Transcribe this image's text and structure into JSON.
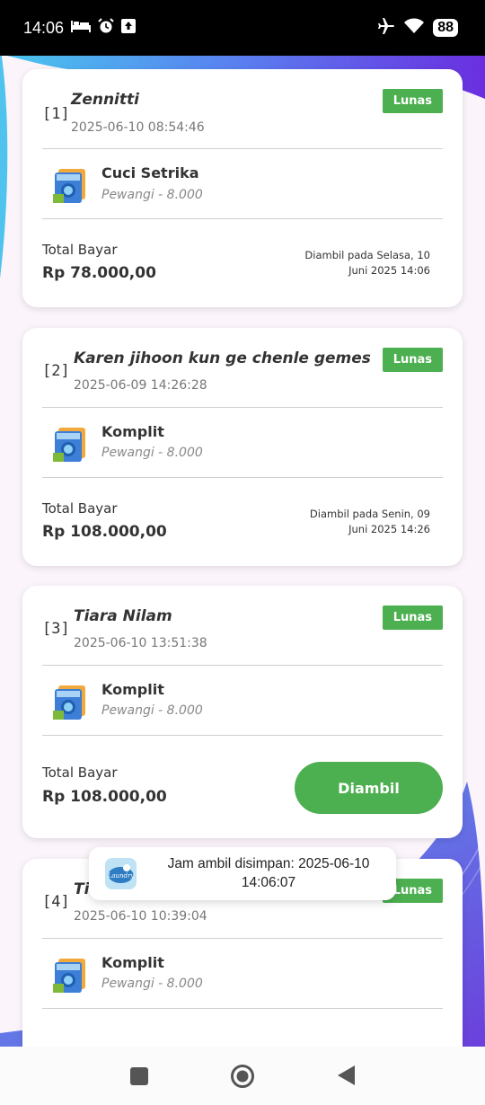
{
  "status": {
    "time": "14:06",
    "battery": "88"
  },
  "orders": [
    {
      "index": "[1]",
      "customer": "Zennitti",
      "date": "2025-06-10 08:54:46",
      "badge": "Lunas",
      "service": "Cuci Setrika",
      "addon": "Pewangi - 8.000",
      "total_label": "Total Bayar",
      "total": "Rp 78.000,00",
      "taken_line1": "Diambil pada Selasa, 10",
      "taken_line2": "Juni 2025 14:06"
    },
    {
      "index": "[2]",
      "customer": "Karen jihoon kun ge chenle gemes",
      "date": "2025-06-09 14:26:28",
      "badge": "Lunas",
      "service": "Komplit",
      "addon": "Pewangi - 8.000",
      "total_label": "Total Bayar",
      "total": "Rp 108.000,00",
      "taken_line1": "Diambil pada Senin, 09",
      "taken_line2": "Juni 2025 14:26"
    },
    {
      "index": "[3]",
      "customer": "Tiara Nilam",
      "date": "2025-06-10 13:51:38",
      "badge": "Lunas",
      "service": "Komplit",
      "addon": "Pewangi - 8.000",
      "total_label": "Total Bayar",
      "total": "Rp 108.000,00",
      "button_label": "Diambil"
    },
    {
      "index": "[4]",
      "customer": "Ti",
      "date": "2025-06-10 10:39:04",
      "badge": "Lunas",
      "service": "Komplit",
      "addon": "Pewangi - 8.000"
    }
  ],
  "toast": {
    "line1": "Jam ambil disimpan: 2025-06-10",
    "line2": "14:06:07",
    "icon_text": "Laundry"
  },
  "colors": {
    "accent_green": "#4caf50",
    "background": "#fbf5fb",
    "wave_blue": "#3fb8e8",
    "wave_purple": "#6a3de8"
  }
}
